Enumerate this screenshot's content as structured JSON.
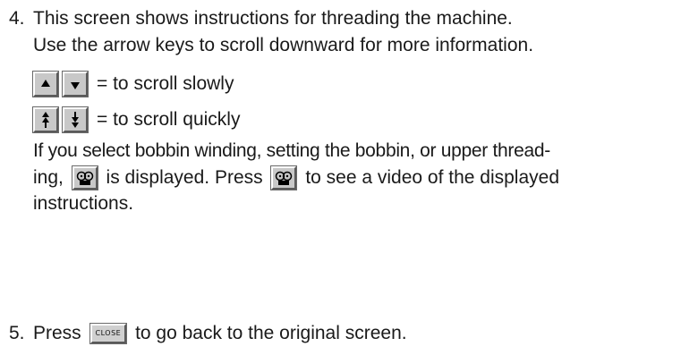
{
  "step4": {
    "number": "4.",
    "line1": "This screen shows instructions for threading the machine.",
    "line2": "Use the arrow keys to scroll downward for more information.",
    "slow_label": "= to scroll slowly",
    "quick_label": "= to scroll quickly",
    "para_line1": "If you select bobbin winding, setting the bobbin, or upper thread-",
    "para_line2_a": "ing,",
    "para_line2_b": "is displayed. Press",
    "para_line2_c": "to see a video of the displayed",
    "para_line3": "instructions."
  },
  "step5": {
    "number": "5.",
    "text_a": "Press",
    "close_key_label": "CLOSE",
    "text_b": "to go back to the original screen."
  },
  "icons": {
    "scroll_up": "triangle-up-icon",
    "scroll_down": "triangle-down-icon",
    "fast_up": "double-arrow-up-icon",
    "fast_down": "double-arrow-down-icon",
    "video": "film-reel-icon"
  }
}
